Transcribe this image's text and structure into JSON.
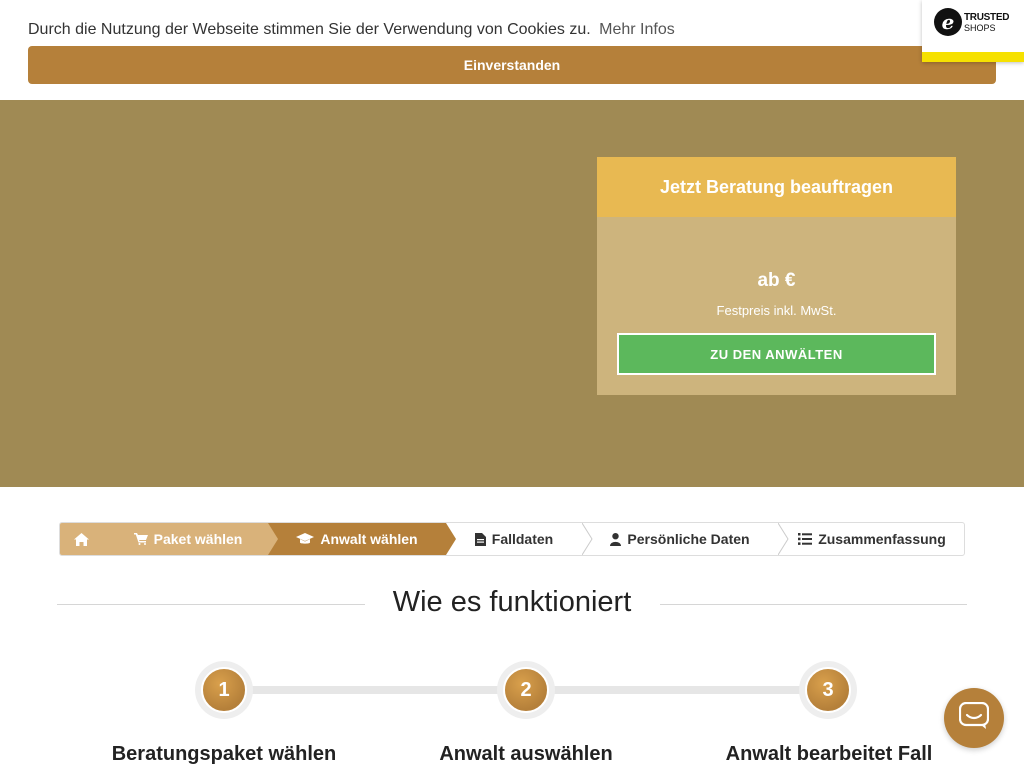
{
  "cookie": {
    "text": "Durch die Nutzung der Webseite stimmen Sie der Verwendung von Cookies zu.",
    "link": "Mehr Infos",
    "button": "Einverstanden"
  },
  "trusted_badge": {
    "line1": "TRUSTED",
    "line2": "SHOPS",
    "mark": "e"
  },
  "card": {
    "title": "Jetzt Beratung beauftragen",
    "price": "ab €",
    "price_note": "Festpreis inkl. MwSt.",
    "cta": "ZU DEN ANWÄLTEN"
  },
  "steps": [
    {
      "label": "",
      "icon": "home-icon"
    },
    {
      "label": "Paket wählen",
      "icon": "cart-icon"
    },
    {
      "label": "Anwalt wählen",
      "icon": "graduation-cap-icon"
    },
    {
      "label": "Falldaten",
      "icon": "file-icon"
    },
    {
      "label": "Persönliche Daten",
      "icon": "user-icon"
    },
    {
      "label": "Zusammenfassung",
      "icon": "list-icon"
    }
  ],
  "section": {
    "title": "Wie es funktioniert"
  },
  "process": [
    {
      "number": "1",
      "label": "Beratungspaket wählen"
    },
    {
      "number": "2",
      "label": "Anwalt auswählen"
    },
    {
      "number": "3",
      "label": "Anwalt bearbeitet Fall"
    }
  ],
  "colors": {
    "accent": "#b5803a",
    "hero": "#a08a54",
    "card": "#cdb47d",
    "card_header": "#e8b952",
    "cta": "#5cb85c"
  }
}
